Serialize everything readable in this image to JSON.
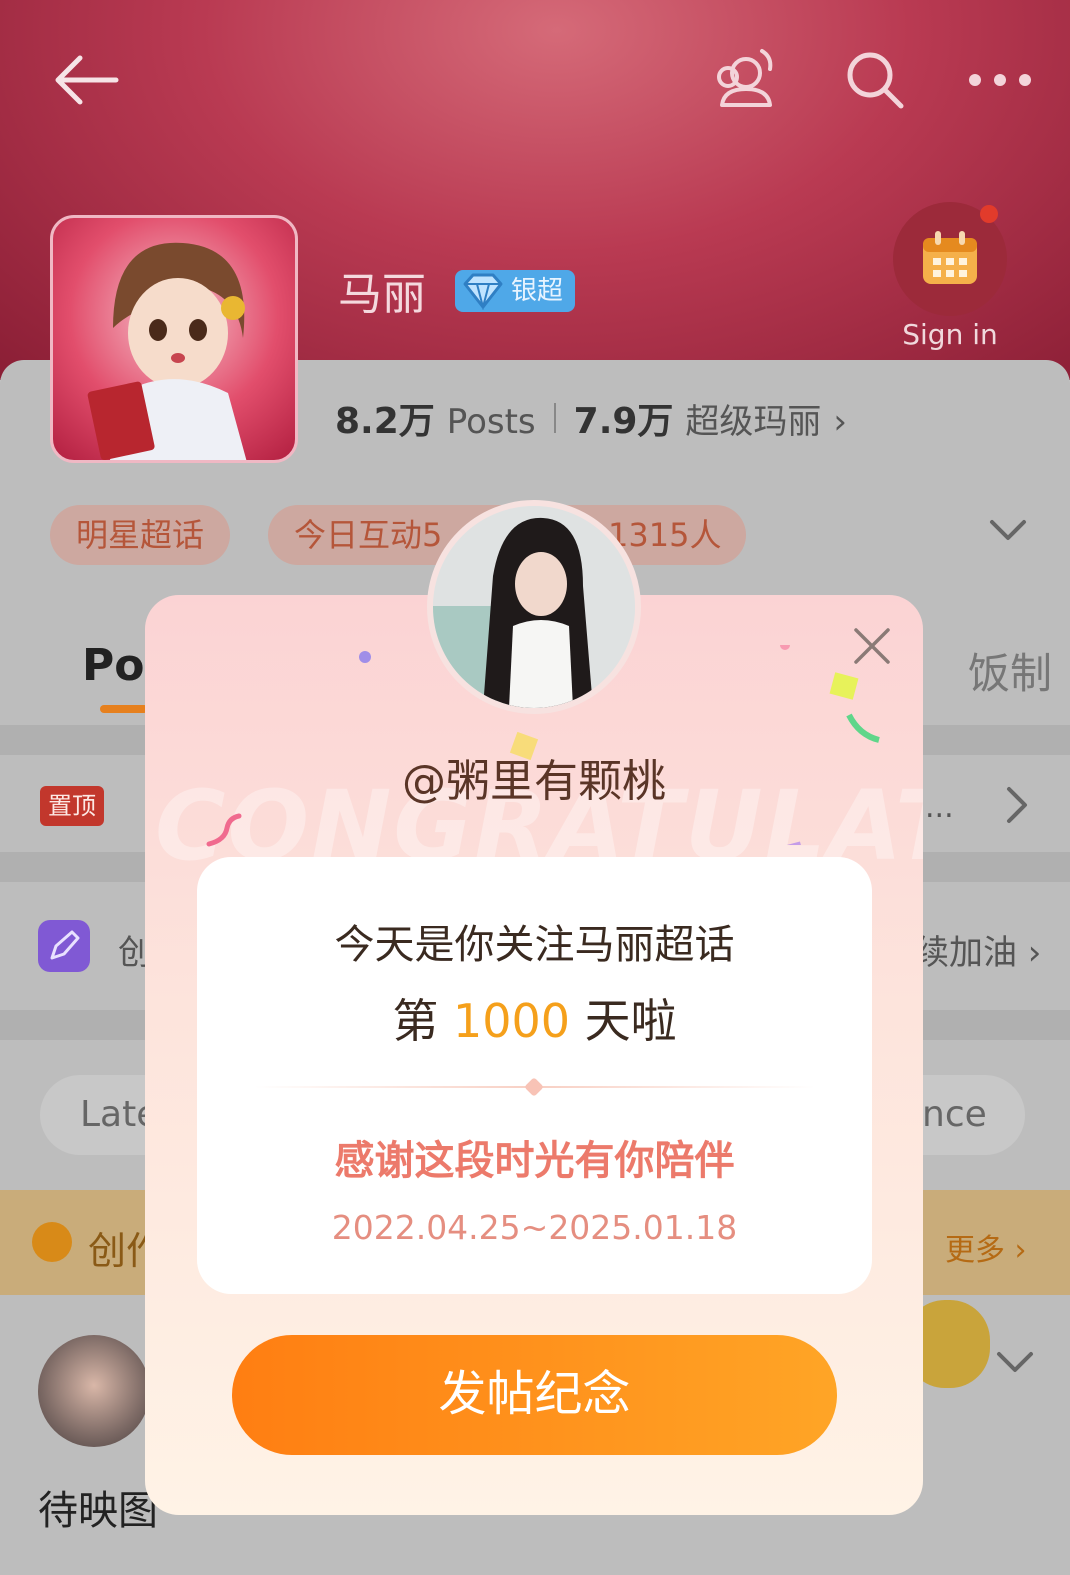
{
  "header": {
    "title": "马丽",
    "badge_label": "银超",
    "signin_label": "Sign in",
    "icons": [
      "back-arrow-icon",
      "fans-icon",
      "search-icon",
      "more-icon",
      "calendar-icon"
    ]
  },
  "stats": {
    "posts_count": "8.2万",
    "posts_label": "Posts",
    "members_count": "7.9万",
    "members_label": "超级玛丽",
    "members_chevron": "›"
  },
  "chips": {
    "category": "明星超话",
    "interaction": "今日互动5 1315人",
    "interaction_start": "今日互动5",
    "interaction_end": "1315人"
  },
  "tabs": {
    "posts": "Pos",
    "fan_made": "饭制"
  },
  "rows": {
    "pinned_tag": "置顶",
    "pinned_ellipsis": "...",
    "creator_left": "创",
    "creator_right": "续加油 ›",
    "sort_latest": "Late",
    "sort_right": "nce",
    "creators_title": "创作",
    "creators_more": "更多 ›",
    "post_text": "待映图"
  },
  "modal": {
    "handle": "@粥里有颗桃",
    "background_text": "CONGRATULATE",
    "line1": "今天是你关注马丽超话",
    "line2_prefix": "第 ",
    "day_count": "1000",
    "line2_suffix": " 天啦",
    "thanks": "感谢这段时光有你陪伴",
    "date_range": "2022.04.25~2025.01.18",
    "button_label": "发帖纪念"
  },
  "colors": {
    "header_red": "#b93a52",
    "accent_orange": "#ff8f1c",
    "day_count_orange": "#f5a01b",
    "thanks_pink": "#ec7a6b",
    "badge_blue": "#4fa8e8",
    "pinned_red": "#c2372c"
  }
}
